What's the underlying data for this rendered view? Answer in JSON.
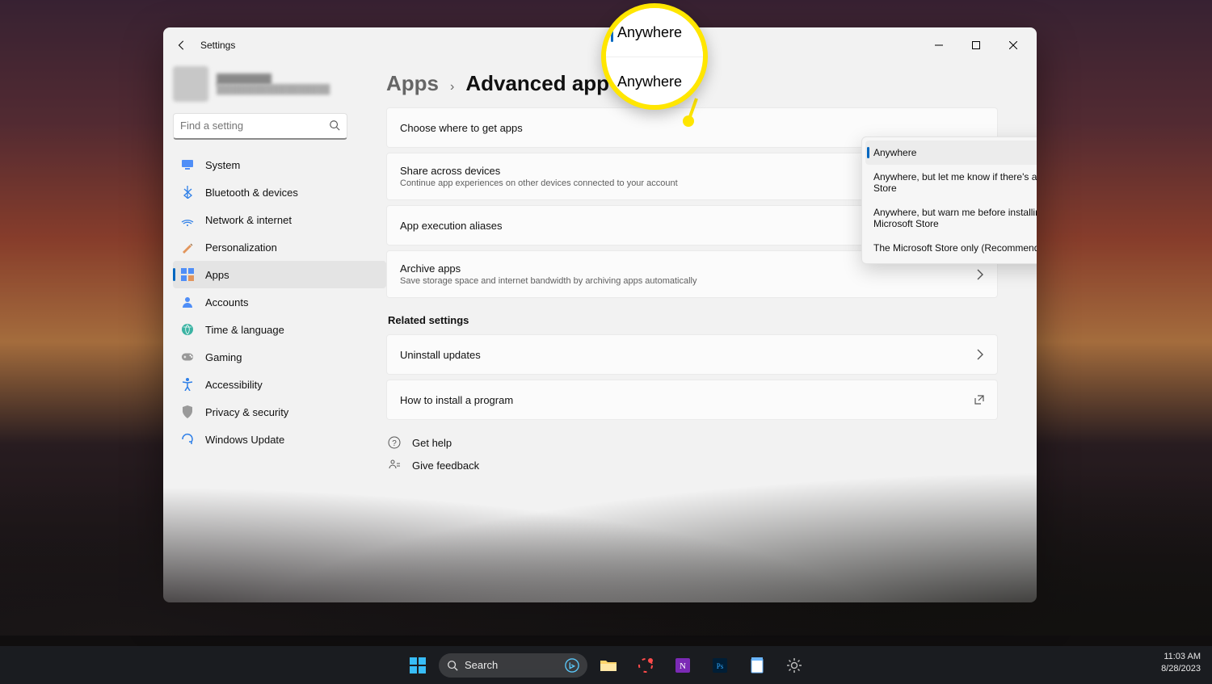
{
  "window": {
    "title": "Settings",
    "user_name": "████████",
    "user_mail": "██████████████████",
    "search_placeholder": "Find a setting"
  },
  "sidebar": [
    {
      "icon": "system",
      "label": "System"
    },
    {
      "icon": "bluetooth",
      "label": "Bluetooth & devices"
    },
    {
      "icon": "network",
      "label": "Network & internet"
    },
    {
      "icon": "personalization",
      "label": "Personalization"
    },
    {
      "icon": "apps",
      "label": "Apps",
      "active": true
    },
    {
      "icon": "accounts",
      "label": "Accounts"
    },
    {
      "icon": "time",
      "label": "Time & language"
    },
    {
      "icon": "gaming",
      "label": "Gaming"
    },
    {
      "icon": "accessibility",
      "label": "Accessibility"
    },
    {
      "icon": "privacy",
      "label": "Privacy & security"
    },
    {
      "icon": "update",
      "label": "Windows Update"
    }
  ],
  "breadcrumb": {
    "parent": "Apps",
    "page": "Advanced app settings"
  },
  "cards": [
    {
      "title": "Choose where to get apps",
      "has_dropdown": true
    },
    {
      "title": "Share across devices",
      "subtitle": "Continue app experiences on other devices connected to your account"
    },
    {
      "title": "App execution aliases",
      "chevron": true
    },
    {
      "title": "Archive apps",
      "subtitle": "Save storage space and internet bandwidth by archiving apps automatically",
      "chevron": true
    }
  ],
  "related_header": "Related settings",
  "related": [
    {
      "title": "Uninstall updates",
      "chevron": true
    },
    {
      "title": "How to install a program",
      "external": true
    }
  ],
  "help": [
    {
      "icon": "help",
      "label": "Get help"
    },
    {
      "icon": "feedback",
      "label": "Give feedback"
    }
  ],
  "dropdown": {
    "selected": 0,
    "items": [
      "Anywhere",
      "Anywhere, but let me know if there's a comparable app in the Microsoft Store",
      "Anywhere, but warn me before installing an app that's not from the Microsoft Store",
      "The Microsoft Store only (Recommended)"
    ]
  },
  "callout": {
    "top": "Anywhere",
    "bottom": "Anywhere"
  },
  "taskbar": {
    "search": "Search",
    "clock_time": "11:03 AM",
    "clock_date": "8/28/2023"
  }
}
